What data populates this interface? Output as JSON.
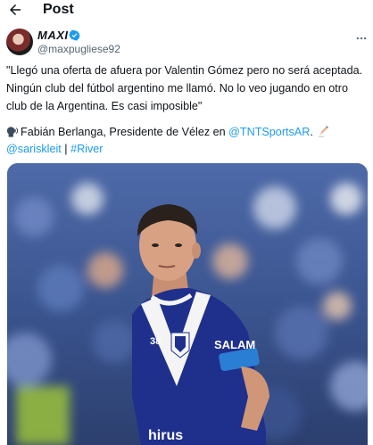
{
  "header": {
    "title": "Post",
    "back_icon": "arrow-left-icon"
  },
  "author": {
    "display_name": "MAXI",
    "handle": "@maxpugliese92",
    "verified_icon": "verified-badge-icon",
    "more_icon": "more-options-icon"
  },
  "tweet": {
    "line1": "\"Llegó una oferta de afuera por Valentin Gómez pero no será aceptada.",
    "line2": "Ningún club del fútbol argentino me llamó. No lo veo jugando en otro",
    "line3": "club de la Argentina. Es casi imposible\"",
    "credit_prefix": "Fabián Berlanga, Presidente de Vélez en ",
    "credit_mention": "@TNTSportsAR",
    "credit_suffix": ".",
    "mention2": "@sariskleit",
    "separator": " | ",
    "hashtag": "#River",
    "speaker_icon": "speaking-head-icon",
    "pen_icon": "writing-hand-icon"
  },
  "media": {
    "description_icon": "photo-icon",
    "jersey_sponsor": "SALAM",
    "jersey_bottom_text": "hirus",
    "jersey_number": "38",
    "colors": {
      "jersey_blue": "#1f2f8c",
      "jersey_white": "#f4f4f4",
      "crowd_blue": "#3d5a9c"
    }
  },
  "colors": {
    "link": "#1d9bf0",
    "text": "#0f1419",
    "muted": "#536471"
  }
}
